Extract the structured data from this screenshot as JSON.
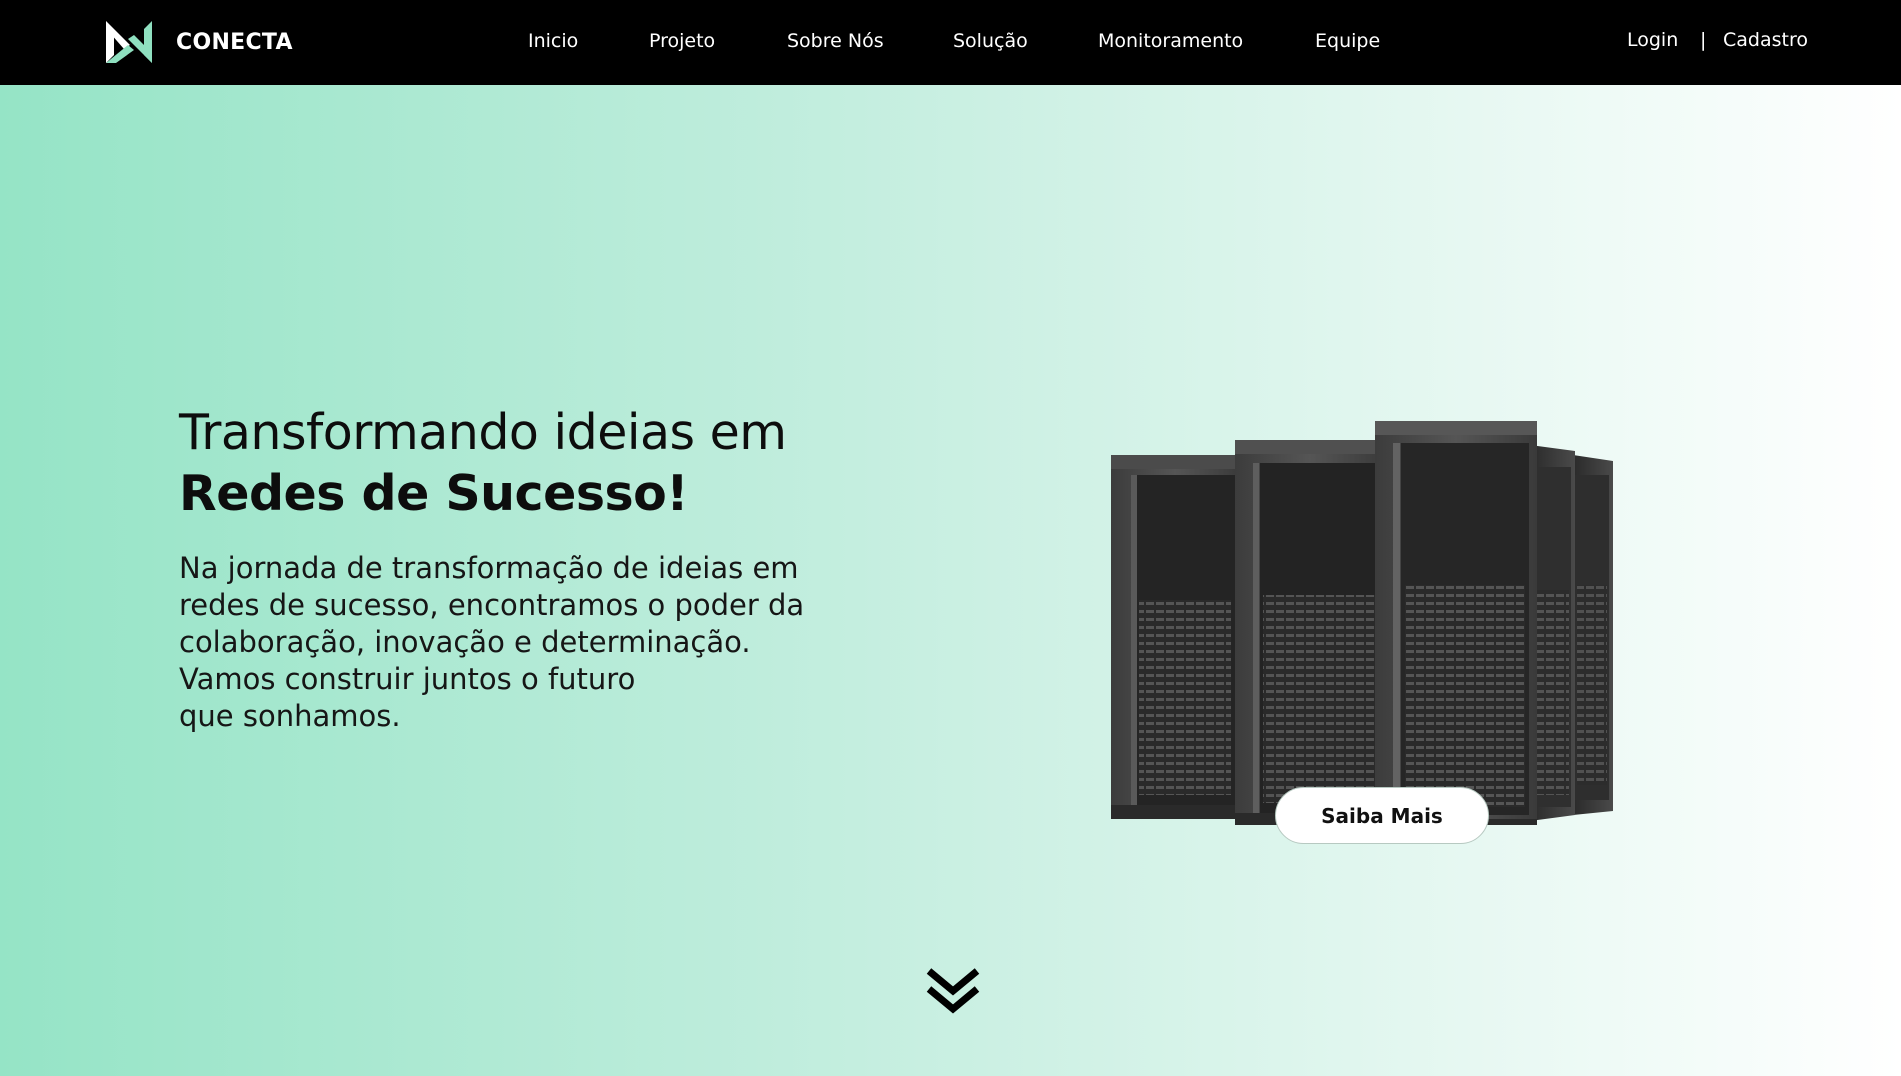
{
  "header": {
    "brand": "CONECTA",
    "nav": [
      "Inicio",
      "Projeto",
      "Sobre Nós",
      "Solução",
      "Monitoramento",
      "Equipe"
    ],
    "login_label": "Login",
    "separator": "|",
    "signup_label": "Cadastro"
  },
  "hero": {
    "headline_line1": "Transformando ideias em",
    "headline_line2": "Redes de Sucesso!",
    "lead_lines": [
      "Na jornada de transformação de ideias em",
      "redes de sucesso, encontramos o poder da",
      "colaboração, inovação e determinação.",
      "Vamos construir juntos o futuro",
      "que sonhamos."
    ],
    "cta_label": "Saiba Mais"
  },
  "icons": {
    "brand_logo": "conecta-logo",
    "scroll": "double-chevron-down-icon",
    "illustration": "server-racks"
  },
  "colors": {
    "navbar": "#000000",
    "hero_gradient_start": "#95e4c6",
    "hero_gradient_end": "#ffffff",
    "logo_accent": "#8fe0c0"
  }
}
